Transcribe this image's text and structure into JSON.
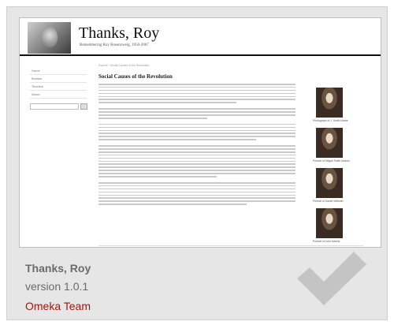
{
  "preview": {
    "site_title": "Thanks, Roy",
    "tagline": "Remembering Roy Rosenzweig, 1950-2007",
    "nav_items": [
      "Home",
      "Browse",
      "Timeline",
      "About"
    ],
    "breadcrumb": "Explore / Social Causes of the Revolution",
    "article_heading": "Social Causes of the Revolution",
    "captions": [
      "Photograph of J. Smith Name",
      "Portrait of Abigail Smith Adams",
      "Portrait of Daniel Webster",
      "Portrait of John Adams"
    ]
  },
  "plugin": {
    "name": "Thanks, Roy",
    "version": "version 1.0.1",
    "author": "Omeka Team",
    "author_color": "#a3150e"
  },
  "icons": {
    "installed": "checkmark-icon"
  }
}
